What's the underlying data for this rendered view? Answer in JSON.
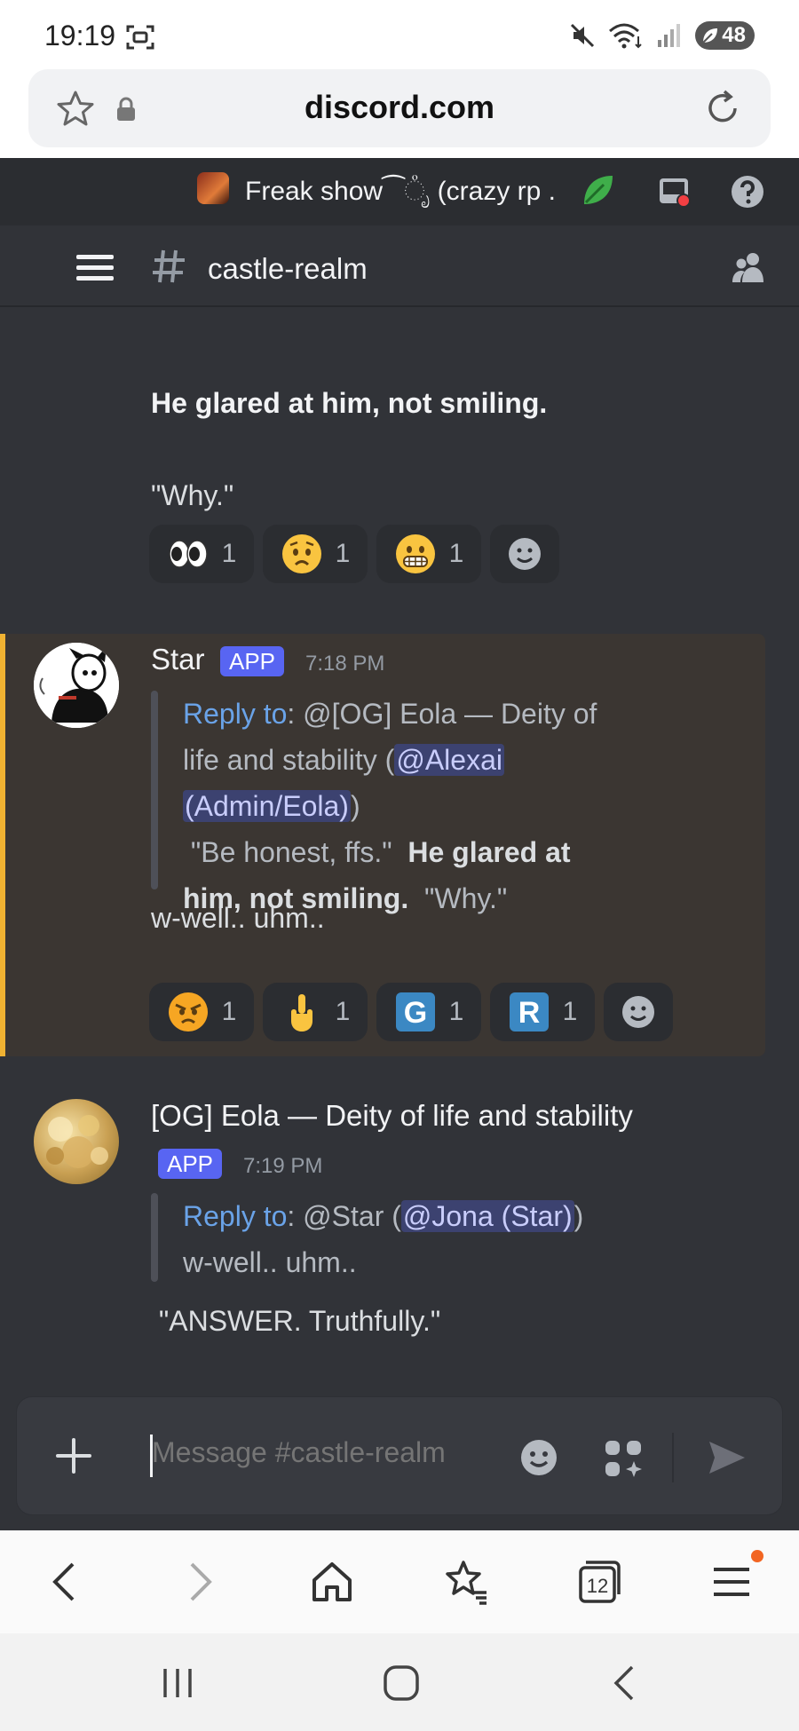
{
  "status_bar": {
    "time": "19:19",
    "battery": "48"
  },
  "browser": {
    "url": "discord.com",
    "tab_count": "12"
  },
  "server": {
    "name": "Freak show⁀ೃͦ (crazy rp ."
  },
  "channel": {
    "name": "castle-realm"
  },
  "messages": [
    {
      "lines": [
        "He glared at him, not smiling.",
        "\"Why.\""
      ],
      "reactions": [
        {
          "emoji": "eyes",
          "count": "1"
        },
        {
          "emoji": "worried-face",
          "count": "1"
        },
        {
          "emoji": "grimacing-face",
          "count": "1"
        }
      ]
    },
    {
      "author": "Star",
      "badge": "APP",
      "time": "7:18 PM",
      "reply": {
        "label": "Reply to",
        "line1_a": ": @[OG] Eola — Deity of",
        "line2_a": "life and stability (",
        "mention_a": "@Alexai",
        "mention_b": "(Admin/Eola)",
        "line3_tail": ")",
        "line4_a": " \"Be honest, ffs.\"  ",
        "line4_b": "He glared at",
        "line5_a": "him, not smiling.",
        "line5_b": "  \"Why.\""
      },
      "text": "w-well.. uhm..",
      "reactions": [
        {
          "emoji": "angry-face",
          "count": "1"
        },
        {
          "emoji": "middle-finger",
          "count": "1"
        },
        {
          "emoji": "letter-g",
          "label": "G",
          "count": "1"
        },
        {
          "emoji": "letter-r",
          "label": "R",
          "count": "1"
        }
      ]
    },
    {
      "author": "[OG] Eola — Deity of life and stability",
      "badge": "APP",
      "time": "7:19 PM",
      "reply": {
        "label": "Reply to",
        "line1_a": ": @Star (",
        "mention": "@Jona (Star)",
        "line1_tail": ")",
        "line2": "w-well.. uhm.."
      },
      "text": " \"ANSWER. Truthfully.\""
    }
  ],
  "composer": {
    "placeholder": "Message #castle-realm"
  }
}
